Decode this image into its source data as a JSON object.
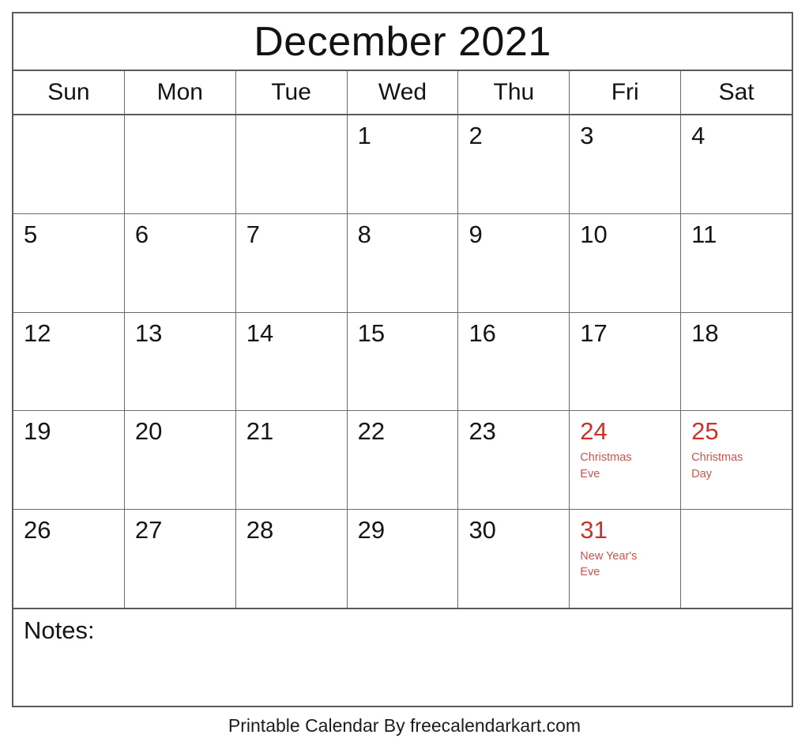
{
  "calendar": {
    "title": "December 2021",
    "month": "December",
    "year": "2021",
    "weekday_headers": [
      {
        "label": "Sun"
      },
      {
        "label": "Mon"
      },
      {
        "label": "Tue"
      },
      {
        "label": "Wed"
      },
      {
        "label": "Thu"
      },
      {
        "label": "Fri"
      },
      {
        "label": "Sat"
      }
    ],
    "weeks": [
      [
        {
          "day": "",
          "event": "",
          "holiday": false,
          "empty": true
        },
        {
          "day": "",
          "event": "",
          "holiday": false,
          "empty": true
        },
        {
          "day": "",
          "event": "",
          "holiday": false,
          "empty": true
        },
        {
          "day": "1",
          "event": "",
          "holiday": false,
          "empty": false
        },
        {
          "day": "2",
          "event": "",
          "holiday": false,
          "empty": false
        },
        {
          "day": "3",
          "event": "",
          "holiday": false,
          "empty": false
        },
        {
          "day": "4",
          "event": "",
          "holiday": false,
          "empty": false
        }
      ],
      [
        {
          "day": "5",
          "event": "",
          "holiday": false,
          "empty": false
        },
        {
          "day": "6",
          "event": "",
          "holiday": false,
          "empty": false
        },
        {
          "day": "7",
          "event": "",
          "holiday": false,
          "empty": false
        },
        {
          "day": "8",
          "event": "",
          "holiday": false,
          "empty": false
        },
        {
          "day": "9",
          "event": "",
          "holiday": false,
          "empty": false
        },
        {
          "day": "10",
          "event": "",
          "holiday": false,
          "empty": false
        },
        {
          "day": "11",
          "event": "",
          "holiday": false,
          "empty": false
        }
      ],
      [
        {
          "day": "12",
          "event": "",
          "holiday": false,
          "empty": false
        },
        {
          "day": "13",
          "event": "",
          "holiday": false,
          "empty": false
        },
        {
          "day": "14",
          "event": "",
          "holiday": false,
          "empty": false
        },
        {
          "day": "15",
          "event": "",
          "holiday": false,
          "empty": false
        },
        {
          "day": "16",
          "event": "",
          "holiday": false,
          "empty": false
        },
        {
          "day": "17",
          "event": "",
          "holiday": false,
          "empty": false
        },
        {
          "day": "18",
          "event": "",
          "holiday": false,
          "empty": false
        }
      ],
      [
        {
          "day": "19",
          "event": "",
          "holiday": false,
          "empty": false
        },
        {
          "day": "20",
          "event": "",
          "holiday": false,
          "empty": false
        },
        {
          "day": "21",
          "event": "",
          "holiday": false,
          "empty": false
        },
        {
          "day": "22",
          "event": "",
          "holiday": false,
          "empty": false
        },
        {
          "day": "23",
          "event": "",
          "holiday": false,
          "empty": false
        },
        {
          "day": "24",
          "event": "Christmas Eve",
          "holiday": true,
          "empty": false
        },
        {
          "day": "25",
          "event": "Christmas Day",
          "holiday": true,
          "empty": false
        }
      ],
      [
        {
          "day": "26",
          "event": "",
          "holiday": false,
          "empty": false
        },
        {
          "day": "27",
          "event": "",
          "holiday": false,
          "empty": false
        },
        {
          "day": "28",
          "event": "",
          "holiday": false,
          "empty": false
        },
        {
          "day": "29",
          "event": "",
          "holiday": false,
          "empty": false
        },
        {
          "day": "30",
          "event": "",
          "holiday": false,
          "empty": false
        },
        {
          "day": "31",
          "event": "New Year's Eve",
          "holiday": true,
          "empty": false
        },
        {
          "day": "",
          "event": "",
          "holiday": false,
          "empty": true
        }
      ]
    ],
    "notes": {
      "label": "Notes:",
      "content": ""
    },
    "footer": {
      "credit": "Printable Calendar By freecalendarkart.com"
    },
    "colors": {
      "holiday_number": "#cc3328",
      "holiday_event": "#c8554f",
      "text": "#151515",
      "border": "#5a5a5a",
      "grid_line": "#6a6a6a",
      "background": "#ffffff"
    }
  }
}
